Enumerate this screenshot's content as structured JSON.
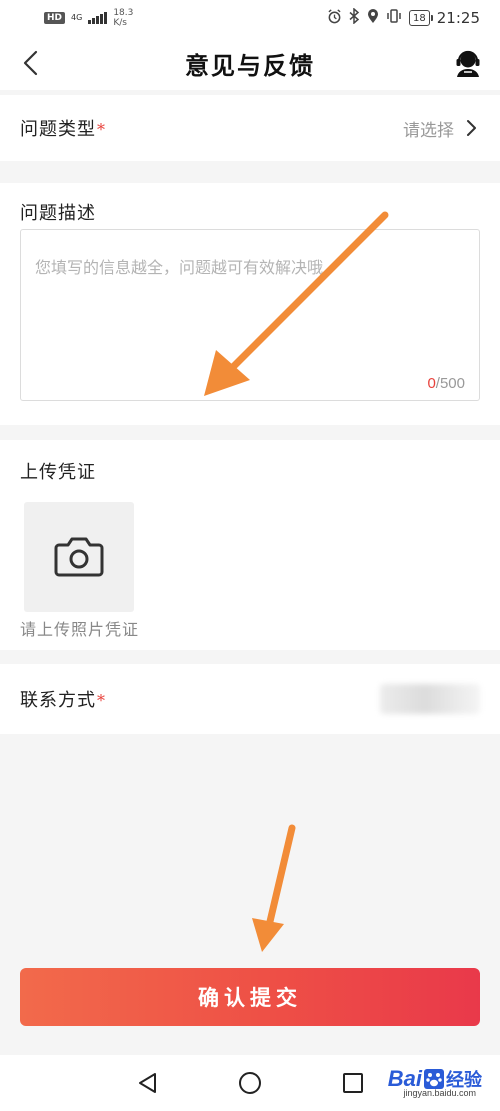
{
  "status_bar": {
    "hd": "HD",
    "network": "4G",
    "speed_value": "18.3",
    "speed_unit": "K/s",
    "battery": "18",
    "time": "21:25",
    "icons": [
      "alarm-icon",
      "bluetooth-icon",
      "location-icon",
      "vibrate-icon",
      "battery-icon"
    ]
  },
  "header": {
    "title": "意见与反馈",
    "back_icon": "chevron-left-icon",
    "service_icon": "customer-service-icon"
  },
  "form": {
    "problem_type": {
      "label": "问题类型",
      "required_mark": "*",
      "placeholder": "请选择"
    },
    "problem_description": {
      "label": "问题描述",
      "placeholder": "您填写的信息越全，问题越可有效解决哦",
      "value": "",
      "count": "0",
      "max_label": "/500"
    },
    "upload": {
      "label": "上传凭证",
      "hint": "请上传照片凭证",
      "icon": "camera-icon"
    },
    "contact": {
      "label": "联系方式",
      "required_mark": "*"
    }
  },
  "submit_label": "确认提交",
  "system_nav": {
    "icons": [
      "back-triangle-icon",
      "home-circle-icon",
      "recents-square-icon"
    ]
  },
  "watermark": {
    "brand_left": "Bai",
    "brand_right": "经验",
    "url": "jingyan.baidu.com"
  },
  "colors": {
    "accent": "#ee4f46",
    "arrow": "#f28c38",
    "required": "#e8413b"
  }
}
